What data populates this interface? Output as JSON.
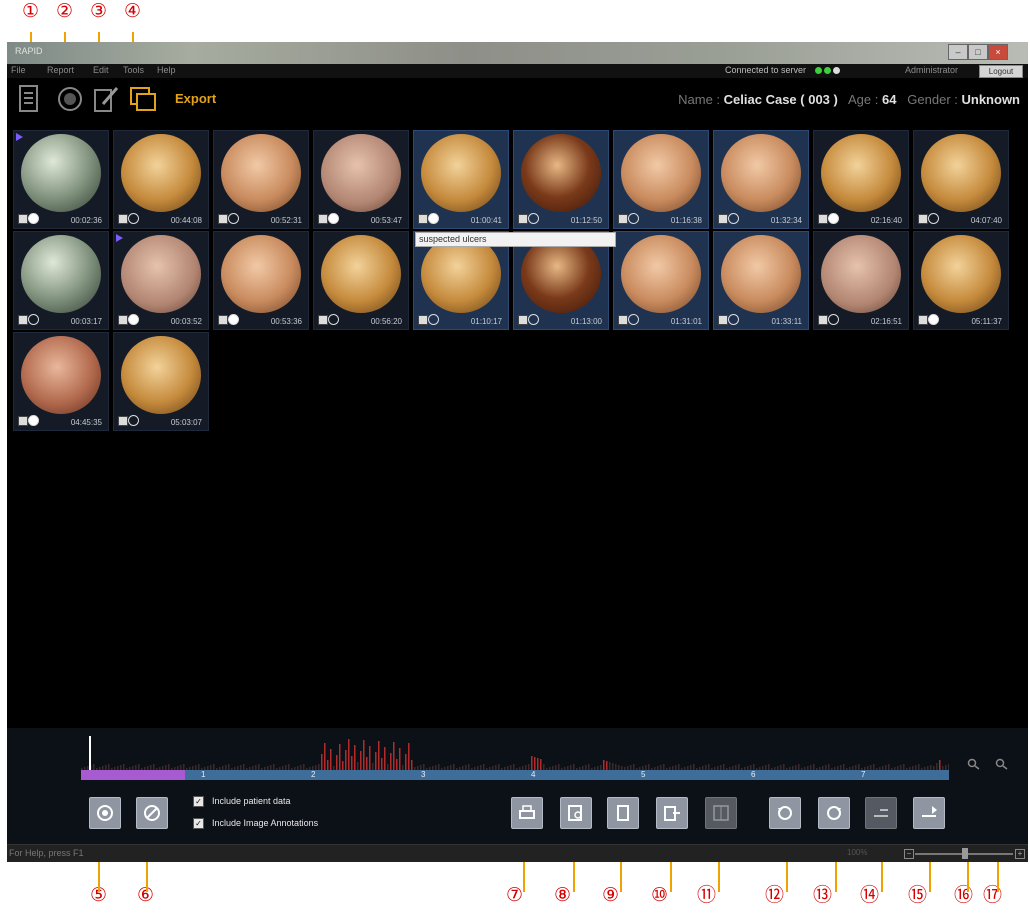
{
  "callouts": [
    "①",
    "②",
    "③",
    "④",
    "⑤",
    "⑥",
    "⑦",
    "⑧",
    "⑨",
    "⑩",
    "⑪",
    "⑫",
    "⑬",
    "⑭",
    "⑮",
    "⑯",
    "⑰"
  ],
  "window": {
    "title": "RAPID"
  },
  "menu": [
    "File",
    "Report",
    "Edit",
    "Tools",
    "Help"
  ],
  "server": {
    "text": "Connected to server",
    "dot_color": "#3ecf3e"
  },
  "user": {
    "name": "Administrator",
    "logout": "Logout"
  },
  "toolbar": {
    "export_label": "Export",
    "accent": "#e2a31b"
  },
  "patient": {
    "name_label": "Name :",
    "name": "Celiac Case ( 003 )",
    "age_label": "Age :",
    "age": "64",
    "gender_label": "Gender :",
    "gender": "Unknown"
  },
  "thumbnails": [
    {
      "time": "00:02:36",
      "tone": "green",
      "dot": "white",
      "flag": true
    },
    {
      "time": "00:44:08",
      "tone": "gold",
      "dot": "none",
      "flag": false
    },
    {
      "time": "00:52:31",
      "tone": "pink",
      "dot": "none",
      "flag": false
    },
    {
      "time": "00:53:47",
      "tone": "pale",
      "dot": "white",
      "flag": false
    },
    {
      "time": "01:00:41",
      "tone": "gold",
      "dot": "white",
      "flag": false,
      "selected": true
    },
    {
      "time": "01:12:50",
      "tone": "dark",
      "dot": "none",
      "flag": false,
      "selected": true
    },
    {
      "time": "01:16:38",
      "tone": "pink",
      "dot": "none",
      "flag": false,
      "selected": true
    },
    {
      "time": "01:32:34",
      "tone": "pink",
      "dot": "none",
      "flag": false,
      "selected": true
    },
    {
      "time": "02:16:40",
      "tone": "gold",
      "dot": "white",
      "flag": false
    },
    {
      "time": "04:07:40",
      "tone": "gold",
      "dot": "none",
      "flag": false
    },
    {
      "time": "00:03:17",
      "tone": "green",
      "dot": "none",
      "flag": false
    },
    {
      "time": "00:03:52",
      "tone": "pale",
      "dot": "white",
      "flag": true
    },
    {
      "time": "00:53:36",
      "tone": "pink",
      "dot": "white",
      "flag": false
    },
    {
      "time": "00:56:20",
      "tone": "gold",
      "dot": "none",
      "flag": false
    },
    {
      "time": "01:10:17",
      "tone": "gold",
      "dot": "none",
      "flag": false,
      "selected": true
    },
    {
      "time": "01:13:00",
      "tone": "dark",
      "dot": "none",
      "flag": false,
      "selected": true
    },
    {
      "time": "01:31:01",
      "tone": "pink",
      "dot": "none",
      "flag": false,
      "selected": true
    },
    {
      "time": "01:33:11",
      "tone": "pink",
      "dot": "none",
      "flag": false,
      "selected": true
    },
    {
      "time": "02:16:51",
      "tone": "pale",
      "dot": "none",
      "flag": false
    },
    {
      "time": "05:11:37",
      "tone": "gold",
      "dot": "white",
      "flag": false
    },
    {
      "time": "04:45:35",
      "tone": "red",
      "dot": "white",
      "flag": false
    },
    {
      "time": "05:03:07",
      "tone": "gold",
      "dot": "none",
      "flag": false
    }
  ],
  "tooltip": "suspected ulcers",
  "timeline": {
    "segments": [
      "1",
      "2",
      "3",
      "4",
      "5",
      "6",
      "7"
    ],
    "viewed_fraction": 0.12
  },
  "options": {
    "include_patient_data": "Include patient data",
    "include_image_annotations": "Include Image Annotations"
  },
  "buttons": {
    "b5": "select-all",
    "b6": "deselect-all",
    "b7": "print",
    "b8": "preview",
    "b9": "export-single",
    "b10": "export-multiple",
    "b11": "grid-layout",
    "b12": "rotate-left",
    "b13": "rotate-right",
    "b14": "move-back",
    "b15": "move-forward"
  },
  "status": {
    "help": "For Help, press F1",
    "zoom": "100%"
  }
}
